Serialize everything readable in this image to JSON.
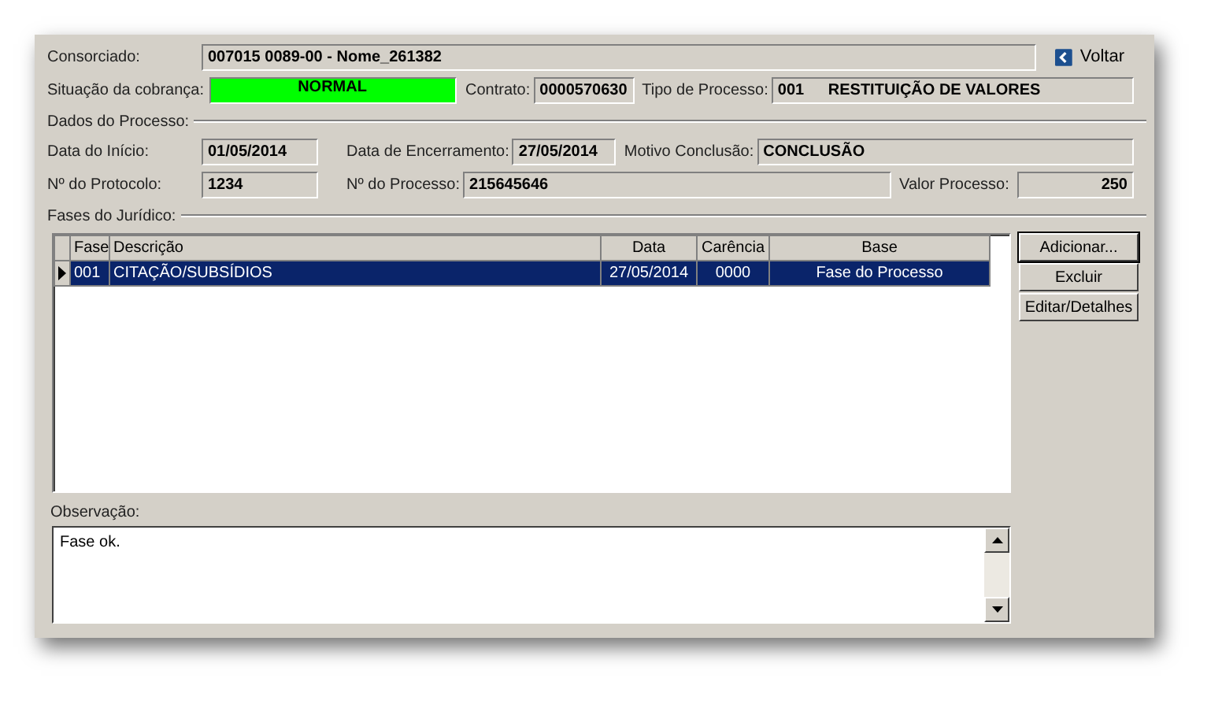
{
  "rows": [
    [
      {
        "kind": "label",
        "text": "Consorciado:"
      },
      {
        "kind": "field",
        "text": "007015 0089-00 - Nome_261382"
      },
      {
        "kind": "back-button",
        "text": "Voltar"
      }
    ],
    [
      {
        "kind": "label",
        "text": "Situação da cobrança:"
      },
      {
        "kind": "status",
        "text": "NORMAL",
        "color": "#00ff00"
      },
      {
        "kind": "label",
        "text": "Contrato:"
      },
      {
        "kind": "field",
        "text": "0000570630"
      },
      {
        "kind": "label",
        "text": "Tipo de Processo:"
      },
      {
        "kind": "code-field",
        "code": "001",
        "text": "RESTITUIÇÃO DE VALORES"
      }
    ],
    [
      {
        "kind": "section",
        "text": "Dados do Processo:"
      }
    ],
    [
      {
        "kind": "label",
        "text": "Data do Início:"
      },
      {
        "kind": "field",
        "text": "01/05/2014"
      },
      {
        "kind": "label",
        "text": "Data de Encerramento:"
      },
      {
        "kind": "field",
        "text": "27/05/2014"
      },
      {
        "kind": "label",
        "text": "Motivo Conclusão:"
      },
      {
        "kind": "field",
        "text": "CONCLUSÃO"
      }
    ],
    [
      {
        "kind": "label",
        "text": "Nº do Protocolo:"
      },
      {
        "kind": "field",
        "text": "1234"
      },
      {
        "kind": "label",
        "text": "Nº do Processo:"
      },
      {
        "kind": "field",
        "text": "215645646"
      },
      {
        "kind": "label",
        "text": "Valor Processo:"
      },
      {
        "kind": "number-field",
        "text": "250"
      }
    ],
    [
      {
        "kind": "section",
        "text": "Fases do Jurídico:"
      }
    ]
  ],
  "grid": {
    "columns": [
      "Fase",
      "Descrição",
      "Data",
      "Carência",
      "Base"
    ],
    "rows": [
      {
        "selected": true,
        "cells": [
          "001",
          "CITAÇÃO/SUBSÍDIOS",
          "27/05/2014",
          "0000",
          "Fase do Processo"
        ]
      }
    ]
  },
  "buttons": [
    "Adicionar...",
    "Excluir",
    "Editar/Detalhes"
  ],
  "observation": {
    "label": "Observação:",
    "value": "Fase ok."
  }
}
